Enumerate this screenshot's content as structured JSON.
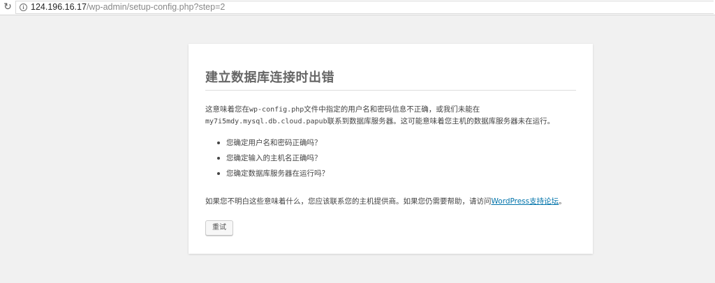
{
  "browser": {
    "url_host": "124.196.16.17",
    "url_path": "/wp-admin/setup-config.php?step=2",
    "reload_icon": "reload-icon",
    "info_icon": "info-icon"
  },
  "error": {
    "title": "建立数据库连接时出错",
    "para1": {
      "before_file": "这意味着您在",
      "file": "wp-config.php",
      "after_file": "文件中指定的用户名和密码信息不正确，或我们未能在",
      "host": "my7i5mdy.mysql.db.cloud.papub",
      "after_host": "联系到数据库服务器。这可能意味着您主机的数据库服务器未在运行。"
    },
    "checks": [
      "您确定用户名和密码正确吗？",
      "您确定输入的主机名正确吗？",
      "您确定数据库服务器在运行吗？"
    ],
    "para2": {
      "before_link": "如果您不明白这些意味着什么，您应该联系您的主机提供商。如果您仍需要帮助，请访问",
      "link_text": "WordPress支持论坛",
      "after_link": "。"
    },
    "retry_label": "重试"
  },
  "colors": {
    "background": "#f1f1f1",
    "card": "#ffffff",
    "link": "#0073aa",
    "title": "#666666"
  }
}
